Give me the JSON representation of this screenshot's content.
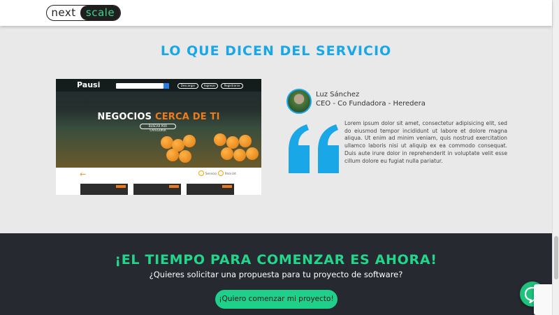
{
  "header": {
    "logo_part1": "next",
    "logo_part2": "scale"
  },
  "testimonials": {
    "title": "LO QUE DICEN DEL SERVICIO",
    "screenshot": {
      "logo": "Pausi",
      "nav_buttons": [
        "Descargar",
        "Ingresar",
        "Registrarse"
      ],
      "headline_white": "NEGOCIOS ",
      "headline_orange": "CERCA DE TI",
      "cta": "BUSCAR POR CATEGORIA",
      "options": [
        "Servicio",
        "Para Ud"
      ]
    },
    "name": "Luz Sánchez",
    "role": "CEO - Co Fundadora - Heredera",
    "quote": "Lorem ipsum dolor sit amet, consectetur adipisicing elit, sed do eiusmod tempor incididunt ut labore et dolore magna aliqua. Ut enim ad minim veniam, quis nostrud exercitation ullamco laboris nisi ut aliquip ex ea commodo consequat. Duis aute irure dolor in reprehenderit in voluptate velit esse cillum dolore eu fugiat nulla pariatur."
  },
  "cta_section": {
    "title": "¡EL TIEMPO PARA COMENZAR ES AHORA!",
    "subtitle": "¿Quieres solicitar una propuesta para tu proyecto de software?",
    "button_label": "¡Quiero comenzar mi proyecto!"
  },
  "colors": {
    "accent_blue": "#1aa7e8",
    "accent_green": "#22d68c",
    "dark_bg": "#262a30",
    "page_bg": "#e9e9e9"
  },
  "icons": {
    "chat": "chat-bubble-icon",
    "quote": "double-quote-icon",
    "search": "search-icon"
  }
}
